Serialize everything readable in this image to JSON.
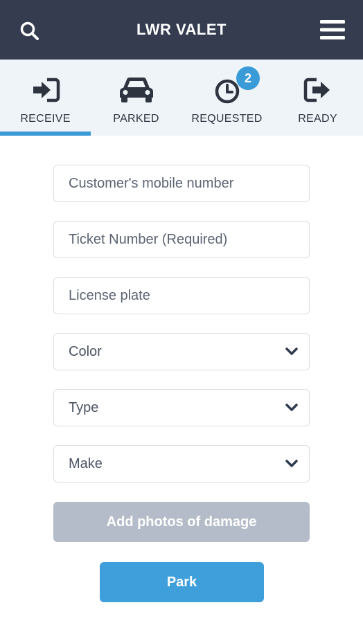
{
  "header": {
    "title": "LWR VALET",
    "search_icon": "search-icon",
    "menu_icon": "hamburger-menu-icon"
  },
  "tabs": [
    {
      "label": "RECEIVE",
      "icon": "sign-in-icon",
      "active": true
    },
    {
      "label": "PARKED",
      "icon": "car-icon",
      "active": false
    },
    {
      "label": "REQUESTED",
      "icon": "clock-icon",
      "active": false,
      "badge": "2"
    },
    {
      "label": "READY",
      "icon": "sign-out-icon",
      "active": false
    }
  ],
  "form": {
    "mobile_placeholder": "Customer's mobile number",
    "ticket_placeholder": "Ticket Number (Required)",
    "plate_placeholder": "License plate",
    "color_value": "Color",
    "type_value": "Type",
    "make_value": "Make",
    "photos_label": "Add photos of damage",
    "park_label": "Park"
  },
  "colors": {
    "header_bg": "#363c50",
    "tab_bg": "#eef4f8",
    "accent": "#3b9ad8",
    "disabled_button": "#b3bcc8"
  }
}
